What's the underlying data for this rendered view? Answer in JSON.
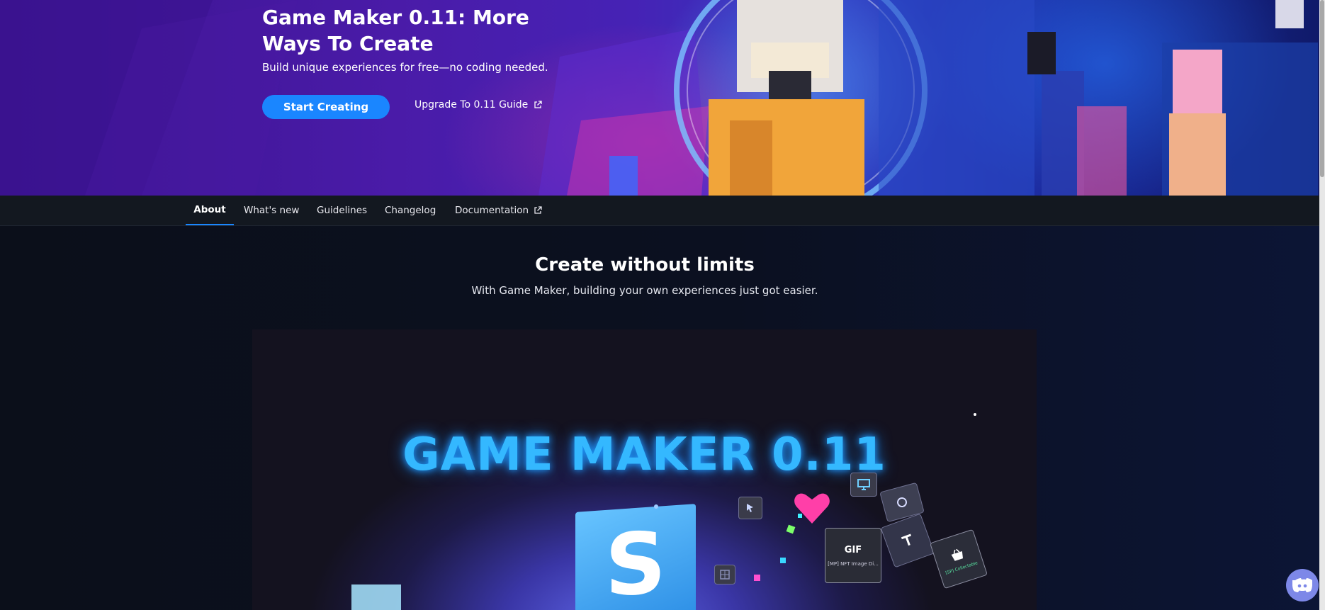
{
  "hero": {
    "title": "Game Maker 0.11: More Ways To Create",
    "subtitle": "Build unique experiences for free—no coding needed.",
    "primary_button": "Start Creating",
    "guide_link": "Upgrade To 0.11 Guide"
  },
  "tabs": [
    {
      "label": "About",
      "active": true
    },
    {
      "label": "What's new",
      "active": false
    },
    {
      "label": "Guidelines",
      "active": false
    },
    {
      "label": "Changelog",
      "active": false
    },
    {
      "label": "Documentation",
      "active": false,
      "external": true
    }
  ],
  "main": {
    "title": "Create without limits",
    "subtitle": "With Game Maker, building your own experiences just got easier."
  },
  "video": {
    "title": "GAME MAKER 0.11",
    "cube_letter": "S",
    "gif_card": {
      "badge": "GIF",
      "caption": "[MP] NFT Image Di..."
    },
    "collectable_card": {
      "caption": "[SP] Collectable"
    }
  },
  "icons": {
    "external_link": "external-link-icon",
    "discord": "discord-icon",
    "cursor": "cursor-icon",
    "monitor": "monitor-icon",
    "basket": "basket-icon"
  },
  "colors": {
    "accent": "#1a86ff",
    "hero_purple": "#4a1ba8",
    "background": "#0b0f1c",
    "neon_title": "#34b8ff",
    "discord": "#7d88e8"
  }
}
